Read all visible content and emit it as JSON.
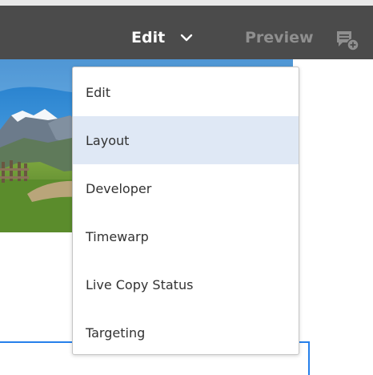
{
  "toolbar": {
    "mode_label": "Edit",
    "preview_label": "Preview",
    "background_color": "#4b4b4b",
    "mode_chevron_icon": "chevron-down-icon",
    "annotate_icon": "annotate-icon"
  },
  "mode_menu": {
    "items": [
      {
        "label": "Edit",
        "selected": false
      },
      {
        "label": "Layout",
        "selected": true
      },
      {
        "label": "Developer",
        "selected": false
      },
      {
        "label": "Timewarp",
        "selected": false
      },
      {
        "label": "Live Copy Status",
        "selected": false
      },
      {
        "label": "Targeting",
        "selected": false
      }
    ],
    "selected_background": "#dfe8f5"
  },
  "colors": {
    "accent": "#2680eb",
    "preview_disabled": "#8f8f8f"
  }
}
